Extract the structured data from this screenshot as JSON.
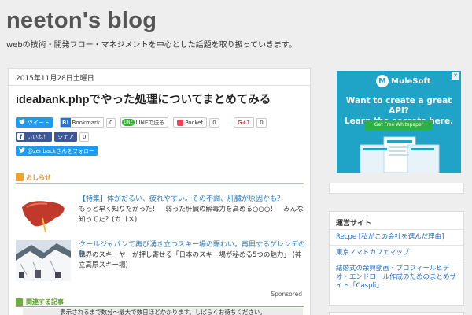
{
  "header": {
    "title": "neeton's blog",
    "description": "webの技術・開発フロー・マネジメントを中心とした話題を取り扱っていきます。"
  },
  "post": {
    "date": "2015年11月28日土曜日",
    "title": "ideabank.phpでやった処理についてまとめてみる",
    "share": {
      "tweet_label": "ツイート",
      "hatena_badge": "B!",
      "hatena_label": "Bookmark",
      "hatena_count": "0",
      "line_badge": "LINE",
      "line_label": "LINEで送る",
      "pocket_label": "Pocket",
      "pocket_count": "0",
      "gplus_label": "G+1",
      "gplus_count": "0",
      "fb_badge": "f",
      "fb_like_label": "いいね！",
      "fb_share_label": "シェア",
      "fb_count": "0",
      "follow_label": "@zenbackさんをフォロー"
    },
    "notice_label": "おしらせ",
    "news": [
      {
        "title": "【特集】体がだるい、疲れやすい。その不調、肝臓が原因かも？",
        "desc": "もっと早く知りたかった！　弱った肝臓の解毒力を高める○○○！　みんな知ってた？(カゴメ)"
      },
      {
        "title": "クールジャパンで再び湧き立つスキー場の賑わい。再興するゲレンデの軌",
        "desc": "世界のスキーヤーが押し寄せる「日本のスキー場が秘める5つの魅力」 (神立高原スキー場)"
      }
    ],
    "sponsored_label": "Sponsored",
    "related_label": "関連する記事",
    "loading_text": "表示されるまで数分〜最大で数日ほどかかります。しばらくお待ちください。"
  },
  "ad": {
    "close": "✕",
    "brand_mark": "M",
    "brand": "MuleSoft",
    "headline_1": "Want to create a great API?",
    "headline_2": "Learn the secrets here.",
    "cta": "Get Free Whitepaper",
    "colors": {
      "background": "#1fa4c8",
      "cta": "#2fb046"
    }
  },
  "sidebar": {
    "section_title": "運営サイト",
    "links": [
      "Recpe [私がこの会社を選んだ理由]",
      "東京ノマドカフェマップ",
      "結婚式の余興動画・プロフィールビデオ・エンドロール作成のためのまとめサイト「Caspli」"
    ]
  }
}
